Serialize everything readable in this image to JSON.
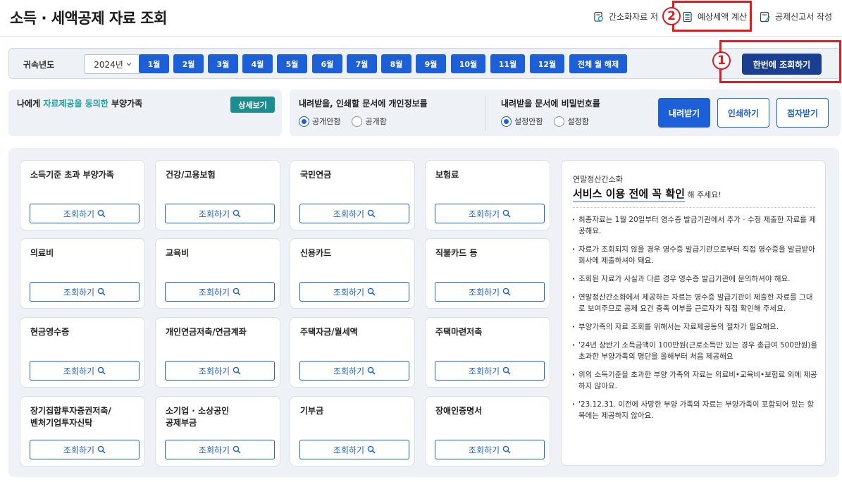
{
  "header": {
    "title": "소득 · 세액공제 자료 조회",
    "links": [
      {
        "label": "간소화자료 저",
        "icon": "document-search-icon"
      },
      {
        "label": "예상세액 계산",
        "icon": "calculator-doc-icon"
      },
      {
        "label": "공제신고서 작성",
        "icon": "pen-doc-icon"
      }
    ]
  },
  "annotations": {
    "marker1": "1",
    "marker2": "2",
    "color": "#e01b22"
  },
  "filter": {
    "label": "귀속년도",
    "year": "2024년",
    "months": [
      "1월",
      "2월",
      "3월",
      "4월",
      "5월",
      "6월",
      "7월",
      "8월",
      "9월",
      "10월",
      "11월",
      "12월"
    ],
    "clear_months": "전체 월 해제",
    "query_all": "한번에 조회하기"
  },
  "consent": {
    "prefix": "나에게 ",
    "highlight": "자료제공을 동의한",
    "suffix": " 부양가족",
    "detail_button": "상세보기"
  },
  "privacy": {
    "title": "내려받을, 인쇄할 문서에 개인정보를",
    "options": [
      "공개안함",
      "공개함"
    ],
    "selected": "공개안함"
  },
  "password": {
    "title": "내려받을 문서에 비밀번호를",
    "options": [
      "설정안함",
      "설정함"
    ],
    "selected": "설정안함"
  },
  "actions": {
    "download": "내려받기",
    "print": "인쇄하기",
    "braille": "점자받기"
  },
  "query_label": "조회하기",
  "cards": [
    [
      "소득기준 초과 부양가족"
    ],
    [
      "건강/고용보험"
    ],
    [
      "국민연금"
    ],
    [
      "보험료"
    ],
    [
      "의료비"
    ],
    [
      "교육비"
    ],
    [
      "신용카드"
    ],
    [
      "직불카드 등"
    ],
    [
      "현금영수증"
    ],
    [
      "개인연금저축/연금계좌"
    ],
    [
      "주택자금/월세액"
    ],
    [
      "주택마련저축"
    ],
    [
      "장기집합투자증권저축/",
      "벤처기업투자신탁"
    ],
    [
      "소기업 · 소상공인",
      "공제부금"
    ],
    [
      "기부금"
    ],
    [
      "장애인증명서"
    ]
  ],
  "notice": {
    "subtitle": "연말정산간소화",
    "headline": "서비스 이용 전에 꼭 확인",
    "headline_suffix": " 해 주세요!",
    "items": [
      "최종자료는 1월 20일부터 영수증 발급기관에서 추가 · 수정 제출한 자료를 제공해요.",
      "자료가 조회되지 않을 경우 영수증 발급기관으로부터 직접 영수증을 발급받아 회사에 제출하셔야 돼요.",
      "조회된 자료가 사실과 다른 경우 영수증 발급기관에 문의하셔야 해요.",
      "연말정산간소화에서 제공하는 자료는 영수증 발급기관이 제출한 자료를 그대로 보여주므로 공제 요건 충족 여부를 근로자가 직접 확인해 주세요.",
      "부양가족의 자료 조회를 위해서는 자료제공동의 절차가 필요해요.",
      "'24년 상반기 소득금액이 100만원(근로소득만 있는 경우 총급여 500만원)을 초과한 부양가족의 명단을 올해부터 처음 제공해요",
      "위의 소득기준을 초과한 부양 가족의 자료는 의료비•교육비•보험료 외에 제공하지 않아요.",
      "'23.12.31. 이전에 사망한 부양 가족의 자료는 부양가족이 포함되어 있는 항목에는 제공하지 않아요."
    ]
  }
}
